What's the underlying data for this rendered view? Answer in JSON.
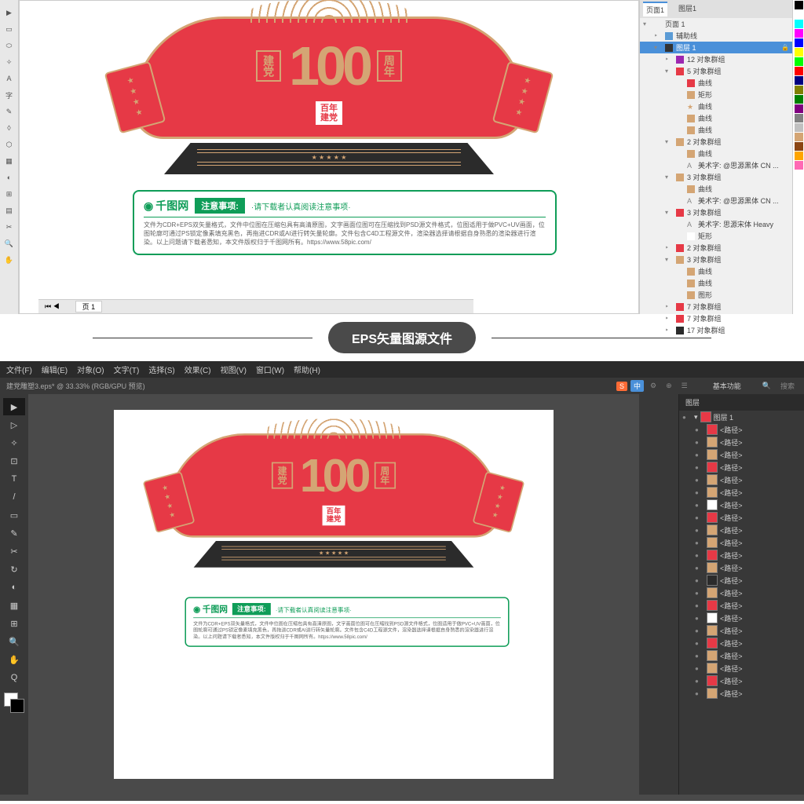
{
  "divider": {
    "label": "EPS矢量图源文件"
  },
  "artwork": {
    "leftBox": "建党",
    "rightBox": "周年",
    "number": "100",
    "seal_l1": "百年",
    "seal_l2": "建党"
  },
  "notice": {
    "brand": "千图网",
    "title": "注意事项:",
    "subtitle": "·请下载者认真阅读注意事项·",
    "body": "文件为CDR+EPS双矢量格式，文件中位图在压缩包具有高清原图，文字画面位图可在压缩找到PSD源文件格式，位图适用于做PVC+UV画面，位图轮廓可通过PS锁定像素填充黑色，再拖进CDR或AI进行转矢量轮廓。文件包含C4D工程源文件，渲染器选择请根据自身熟悉的渲染器进行渲染。以上问题请下载者悉知，本文件版权归于千图网所有。https://www.58pic.com/"
  },
  "cdr": {
    "tabs": {
      "t1": "页面1",
      "t2": "图层1"
    },
    "pageTab": "页 1",
    "layers": [
      {
        "lv": 0,
        "toggle": "▾",
        "name": "页面 1",
        "color": ""
      },
      {
        "lv": 1,
        "toggle": "‣",
        "name": "辅助线",
        "color": "#5b9bd5"
      },
      {
        "lv": 1,
        "toggle": "▾",
        "name": "图层 1",
        "color": "#333",
        "sel": true,
        "lock": true
      },
      {
        "lv": 2,
        "toggle": "‣",
        "name": "12 对象群组",
        "color": "#9c27b0"
      },
      {
        "lv": 2,
        "toggle": "▾",
        "name": "5 对象群组",
        "color": "#e63946"
      },
      {
        "lv": 3,
        "toggle": "",
        "name": "曲线",
        "color": "#e63946",
        "type": "curve"
      },
      {
        "lv": 3,
        "toggle": "",
        "name": "矩形",
        "color": "#d4a574",
        "type": "rect"
      },
      {
        "lv": 3,
        "toggle": "",
        "name": "曲线",
        "color": "#d4a574",
        "type": "star"
      },
      {
        "lv": 3,
        "toggle": "",
        "name": "曲线",
        "color": "#d4a574",
        "type": "curve"
      },
      {
        "lv": 3,
        "toggle": "",
        "name": "曲线",
        "color": "#d4a574",
        "type": "curve"
      },
      {
        "lv": 2,
        "toggle": "▾",
        "name": "2 对象群组",
        "color": "#d4a574"
      },
      {
        "lv": 3,
        "toggle": "",
        "name": "曲线",
        "color": "#d4a574",
        "type": "curve"
      },
      {
        "lv": 3,
        "toggle": "",
        "name": "美术字: @思源黑体 CN ...",
        "color": "",
        "type": "text"
      },
      {
        "lv": 2,
        "toggle": "▾",
        "name": "3 对象群组",
        "color": "#d4a574"
      },
      {
        "lv": 3,
        "toggle": "",
        "name": "曲线",
        "color": "#d4a574",
        "type": "curve"
      },
      {
        "lv": 3,
        "toggle": "",
        "name": "美术字: @思源黑体 CN ...",
        "color": "",
        "type": "text"
      },
      {
        "lv": 2,
        "toggle": "▾",
        "name": "3 对象群组",
        "color": "#e63946"
      },
      {
        "lv": 3,
        "toggle": "",
        "name": "美术字: 思源宋体 Heavy",
        "color": "",
        "type": "text"
      },
      {
        "lv": 3,
        "toggle": "",
        "name": "矩形",
        "color": "#fff",
        "type": "rect"
      },
      {
        "lv": 2,
        "toggle": "‣",
        "name": "2 对象群组",
        "color": "#e63946"
      },
      {
        "lv": 2,
        "toggle": "▾",
        "name": "3 对象群组",
        "color": "#d4a574"
      },
      {
        "lv": 3,
        "toggle": "",
        "name": "曲线",
        "color": "#d4a574",
        "type": "curve"
      },
      {
        "lv": 3,
        "toggle": "",
        "name": "曲线",
        "color": "#d4a574",
        "type": "curve"
      },
      {
        "lv": 3,
        "toggle": "",
        "name": "图形",
        "color": "#d4a574",
        "type": "shape"
      },
      {
        "lv": 2,
        "toggle": "‣",
        "name": "7 对象群组",
        "color": "#e63946"
      },
      {
        "lv": 2,
        "toggle": "‣",
        "name": "7 对象群组",
        "color": "#e63946"
      },
      {
        "lv": 2,
        "toggle": "‣",
        "name": "17 对象群组",
        "color": "#2b2b2b"
      }
    ],
    "tools": [
      "▶",
      "▭",
      "⬭",
      "✧",
      "A",
      "字",
      "✎",
      "◊",
      "⬡",
      "▦",
      "◐",
      "⊞",
      "▤",
      "✂",
      "🔍",
      "✋"
    ],
    "colors": [
      "#000",
      "#fff",
      "#00ffff",
      "#ff00ff",
      "#0000ff",
      "#ffff00",
      "#00ff00",
      "#ff0000",
      "#000080",
      "#808000",
      "#008000",
      "#800080",
      "#808080",
      "#c0c0c0",
      "#d4a574",
      "#8b4513",
      "#ffa500",
      "#ff69b4"
    ]
  },
  "ai": {
    "menus": [
      "文件(F)",
      "编辑(E)",
      "对象(O)",
      "文字(T)",
      "选择(S)",
      "效果(C)",
      "视图(V)",
      "窗口(W)",
      "帮助(H)"
    ],
    "docTitle": "建党雕塑3.eps* @ 33.33% (RGB/GPU 预览)",
    "panelRight": "基本功能",
    "search": "搜索",
    "badge_s": "S",
    "badge_cn": "中",
    "layerPanel": "图层",
    "layerMain": "图层 1",
    "sublayerPrefix": "<路径>",
    "tools": [
      "▶",
      "▷",
      "✧",
      "⊡",
      "T",
      "/",
      "▭",
      "✎",
      "✂",
      "↻",
      "◐",
      "▦",
      "⊞",
      "🔍",
      "✋",
      "Q"
    ],
    "thumbColors": [
      "#e63946",
      "#d4a574",
      "#d4a574",
      "#e63946",
      "#d4a574",
      "#d4a574",
      "#fff",
      "#e63946",
      "#d4a574",
      "#d4a574",
      "#e63946",
      "#d4a574",
      "#2b2b2b",
      "#d4a574",
      "#e63946",
      "#fff",
      "#d4a574",
      "#e63946",
      "#d4a574",
      "#d4a574",
      "#e63946",
      "#d4a574"
    ]
  }
}
